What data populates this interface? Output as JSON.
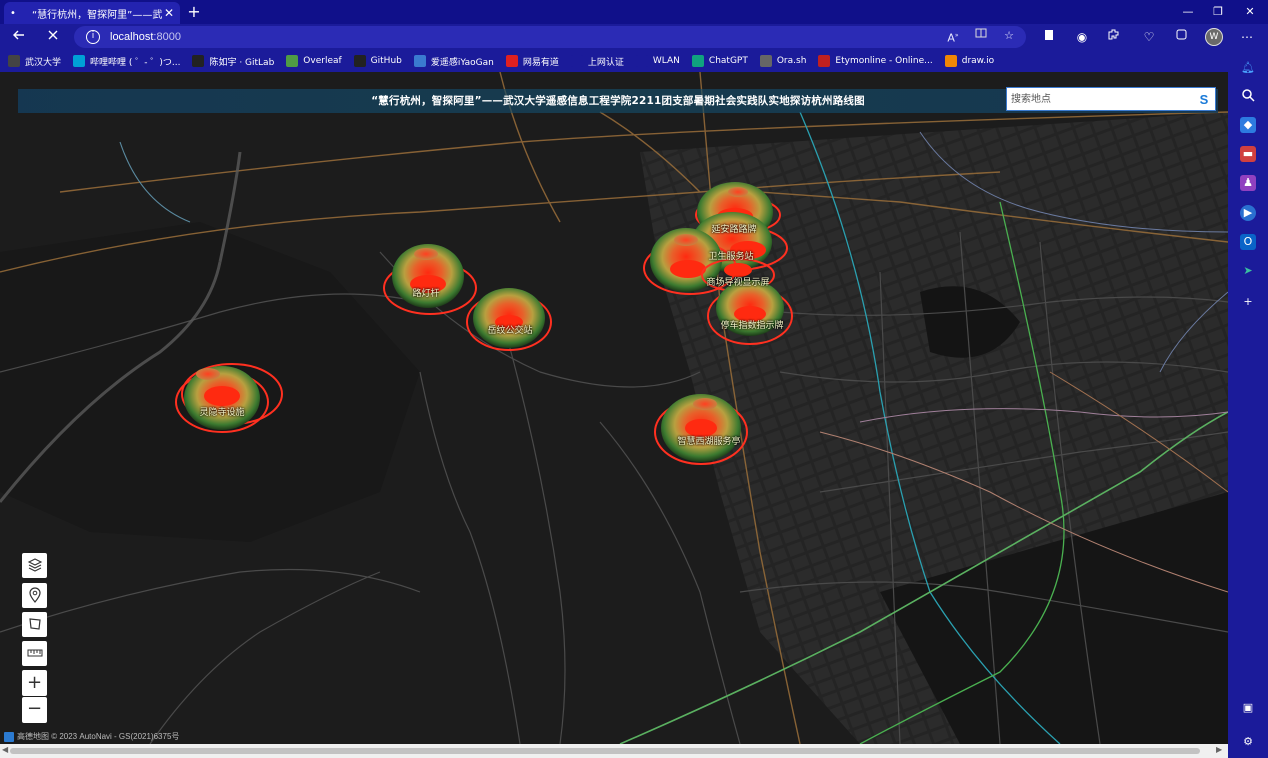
{
  "browser": {
    "tab_title": "“慧行杭州，智探阿里”——武汉大",
    "url_host": "localhost",
    "url_port": ":8000",
    "new_tab_symbol": "+",
    "tab_close": "✕",
    "tab_dot": "•",
    "window_controls": [
      "—",
      "❐",
      "✕"
    ]
  },
  "bookmarks": [
    {
      "label": "武汉大学",
      "icon": "university-icon",
      "color": "#444444"
    },
    {
      "label": "哔哩哔哩 ( ゜- ゜)つ...",
      "icon": "bilibili-icon",
      "color": "#00a1d6"
    },
    {
      "label": "陈如宇 · GitLab",
      "icon": "gitlab-icon",
      "color": "#222222"
    },
    {
      "label": "Overleaf",
      "icon": "overleaf-icon",
      "color": "#4f9c45"
    },
    {
      "label": "GitHub",
      "icon": "github-icon",
      "color": "#222222"
    },
    {
      "label": "爱遥感iYaoGan",
      "icon": "iyaogan-icon",
      "color": "#3a7ad0"
    },
    {
      "label": "网易有道",
      "icon": "youdao-icon",
      "color": "#e02020"
    },
    {
      "label": "上网认证",
      "icon": "document-icon",
      "color": "#1b1b9a"
    },
    {
      "label": "WLAN",
      "icon": "document-icon",
      "color": "#1b1b9a"
    },
    {
      "label": "ChatGPT",
      "icon": "chatgpt-icon",
      "color": "#10a37f"
    },
    {
      "label": "Ora.sh",
      "icon": "ora-icon",
      "color": "#666666"
    },
    {
      "label": "Etymonline - Online...",
      "icon": "etymonline-icon",
      "color": "#c02020"
    },
    {
      "label": "draw.io",
      "icon": "drawio-icon",
      "color": "#f08705"
    }
  ],
  "map": {
    "banner_title": "“慧行杭州，智探阿里”——武汉大学遥感信息工程学院2211团支部暑期社会实践队实地探访杭州路线图",
    "search": {
      "placeholder": "搜索地点",
      "icon_glyph": "S"
    },
    "zoom_in": "+",
    "zoom_out": "−",
    "attribution": "高德地图 © 2023 AutoNavi - GS(2021)6375号",
    "poi_labels": [
      "延安路路牌",
      "卫生服务站",
      "商场导视显示屏",
      "停车指数指示牌",
      "路灯杆",
      "岳纹公交站",
      "灵隐寺设施",
      "智慧西湖服务亭"
    ]
  }
}
